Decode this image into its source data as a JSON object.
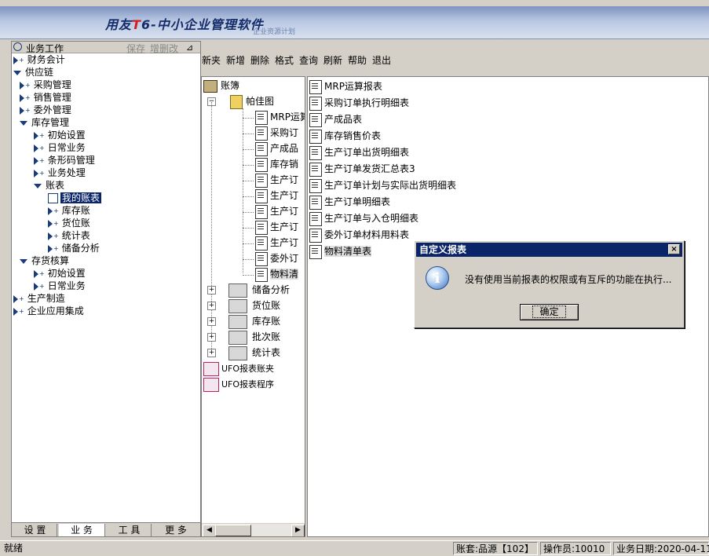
{
  "banner": {
    "brand_prefix": "用友",
    "brand_t": "T",
    "brand_rest": "6-中小企业管理软件",
    "brand_sub": "企业资源计划"
  },
  "left_panel": {
    "title": "业务工作",
    "save": "保存",
    "add_delete": "增删改",
    "tree": [
      {
        "label": "财务会计",
        "state": "collapsed",
        "level": 0
      },
      {
        "label": "供应链",
        "state": "expanded",
        "level": 0
      },
      {
        "label": "采购管理",
        "state": "collapsed",
        "level": 1
      },
      {
        "label": "销售管理",
        "state": "collapsed",
        "level": 1
      },
      {
        "label": "委外管理",
        "state": "collapsed",
        "level": 1
      },
      {
        "label": "库存管理",
        "state": "expanded",
        "level": 1
      },
      {
        "label": "初始设置",
        "state": "collapsed",
        "level": 2
      },
      {
        "label": "日常业务",
        "state": "collapsed",
        "level": 2
      },
      {
        "label": "条形码管理",
        "state": "collapsed",
        "level": 2
      },
      {
        "label": "业务处理",
        "state": "collapsed",
        "level": 2
      },
      {
        "label": "账表",
        "state": "expanded",
        "level": 2
      },
      {
        "label": "我的账表",
        "state": "selected",
        "level": 3
      },
      {
        "label": "库存账",
        "state": "collapsed",
        "level": 3
      },
      {
        "label": "货位账",
        "state": "collapsed",
        "level": 3
      },
      {
        "label": "统计表",
        "state": "collapsed",
        "level": 3
      },
      {
        "label": "储备分析",
        "state": "collapsed",
        "level": 3
      },
      {
        "label": "存货核算",
        "state": "expanded",
        "level": 1
      },
      {
        "label": "初始设置",
        "state": "collapsed",
        "level": 2
      },
      {
        "label": "日常业务",
        "state": "collapsed",
        "level": 2
      },
      {
        "label": "生产制造",
        "state": "collapsed",
        "level": 0
      },
      {
        "label": "企业应用集成",
        "state": "collapsed",
        "level": 0
      }
    ],
    "tabs": [
      "设 置",
      "业 务",
      "工 具",
      "更 多"
    ]
  },
  "toolbar": [
    "新夹",
    "新增",
    "删除",
    "格式",
    "查询",
    "刷新",
    "帮助",
    "退出"
  ],
  "mid_tree": {
    "root": "账簿",
    "folder": "帕佳图",
    "folder_children": [
      "MRP运算",
      "采购订",
      "产成品",
      "库存销",
      "生产订",
      "生产订",
      "生产订",
      "生产订",
      "生产订",
      "委外订",
      "物料清"
    ],
    "groups": [
      "储备分析",
      "货位账",
      "库存账",
      "批次账",
      "统计表"
    ],
    "ufo": [
      "UFO报表账夹",
      "UFO报表程序"
    ]
  },
  "right_list": [
    "MRP运算报表",
    "采购订单执行明细表",
    "产成品表",
    "库存销售价表",
    "生产订单出货明细表",
    "生产订单发货汇总表3",
    "生产订单计划与实际出货明细表",
    "生产订单明细表",
    "生产订单与入仓明细表",
    "委外订单材料用料表",
    "物料清单表"
  ],
  "dialog": {
    "title": "自定义报表",
    "close": "×",
    "message": "没有使用当前报表的权限或有互斥的功能在执行...",
    "ok": "确定"
  },
  "statusbar": {
    "ready": "就绪",
    "account": "账套:品源【102】",
    "operator": "操作员:10010",
    "date": "业务日期:2020-04-11"
  }
}
